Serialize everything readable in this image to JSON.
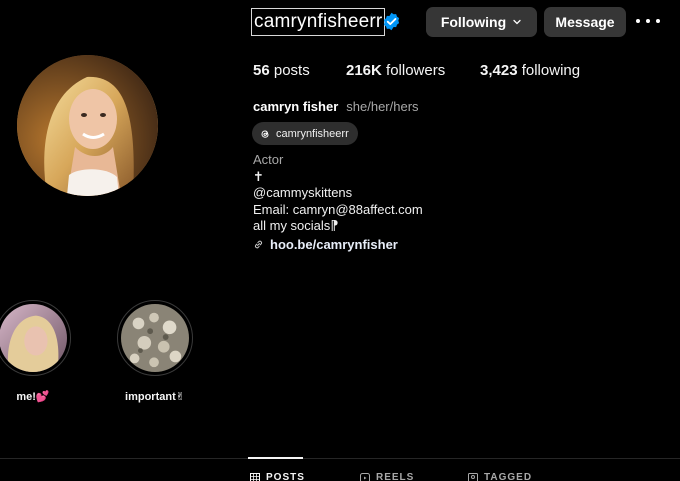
{
  "profile": {
    "username": "camrynfisheerr",
    "verified": true,
    "buttons": {
      "following_label": "Following",
      "message_label": "Message"
    }
  },
  "stats": {
    "posts": "56",
    "posts_label": "posts",
    "followers": "216K",
    "followers_label": "followers",
    "following": "3,423",
    "following_label": "following"
  },
  "bio": {
    "display_name": "camryn fisher",
    "pronouns": "she/her/hers",
    "threads_handle": "camrynfisheerr",
    "category": "Actor",
    "lines": [
      "✝",
      "@cammyskittens",
      "Email: camryn@88affect.com",
      "all my socials⁋"
    ],
    "link": "hoo.be/camrynfisher"
  },
  "highlights": [
    {
      "label": "me!💕"
    },
    {
      "label": "important✌"
    }
  ],
  "tabs": [
    {
      "label": "POSTS",
      "active": true
    },
    {
      "label": "REELS",
      "active": false
    },
    {
      "label": "TAGGED",
      "active": false
    }
  ],
  "colors": {
    "background": "#000000",
    "button_bg": "#363636",
    "verified_blue": "#0095f6",
    "muted_text": "#a8a8a8"
  }
}
